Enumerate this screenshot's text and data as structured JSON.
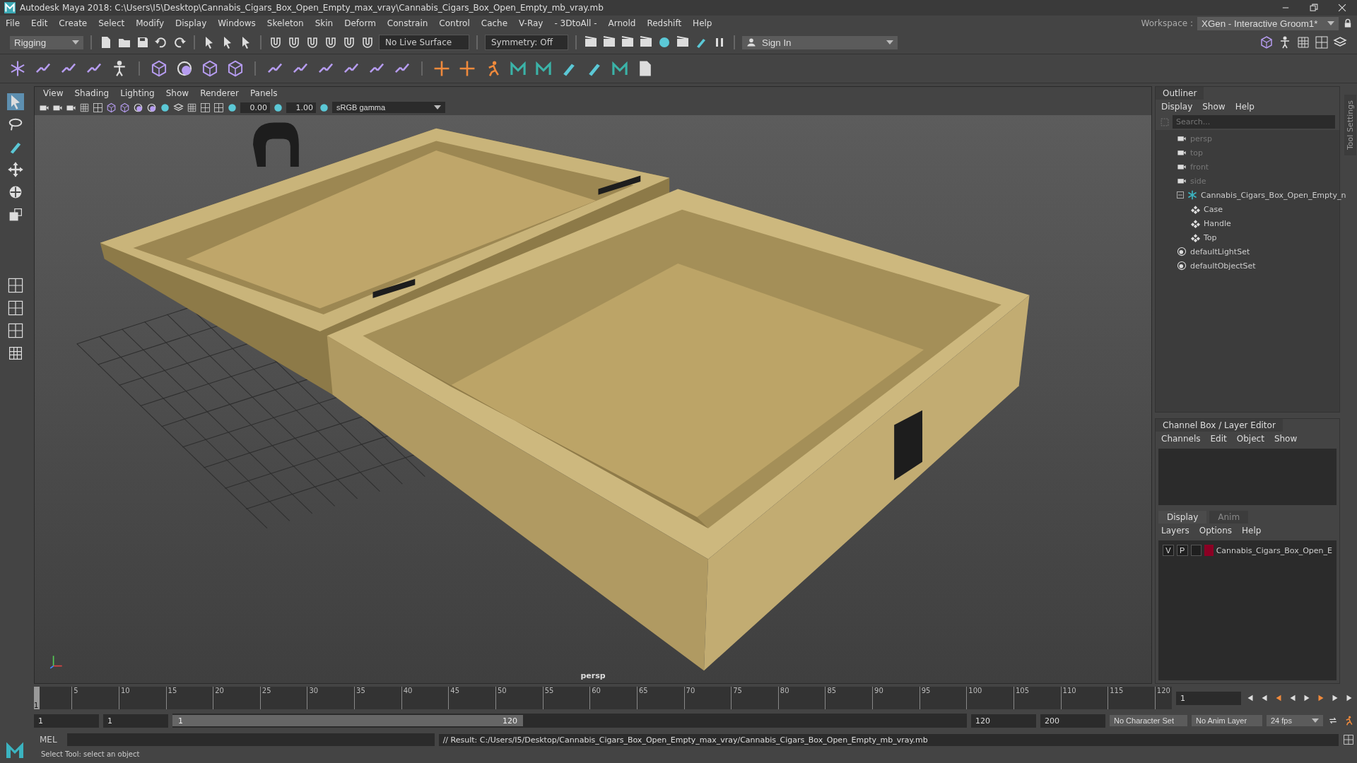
{
  "window": {
    "title": "Autodesk Maya 2018: C:\\Users\\I5\\Desktop\\Cannabis_Cigars_Box_Open_Empty_max_vray\\Cannabis_Cigars_Box_Open_Empty_mb_vray.mb"
  },
  "menu": [
    "File",
    "Edit",
    "Create",
    "Select",
    "Modify",
    "Display",
    "Windows",
    "Skeleton",
    "Skin",
    "Deform",
    "Constrain",
    "Control",
    "Cache",
    "V-Ray",
    "- 3DtoAll -",
    "Arnold",
    "Redshift",
    "Help"
  ],
  "workspace": {
    "label": "Workspace :",
    "value": "XGen - Interactive Groom1*"
  },
  "status_line": {
    "mode": "Rigging",
    "live_surface": "No Live Surface",
    "symmetry": "Symmetry: Off",
    "sign_in": "Sign In"
  },
  "viewport": {
    "menu": [
      "View",
      "Shading",
      "Lighting",
      "Show",
      "Renderer",
      "Panels"
    ],
    "exposure": "0.00",
    "gamma": "1.00",
    "color_space": "sRGB gamma",
    "camera": "persp"
  },
  "outliner": {
    "title": "Outliner",
    "menu": [
      "Display",
      "Show",
      "Help"
    ],
    "search": {
      "placeholder": "Search..."
    },
    "items": [
      {
        "label": "persp",
        "kind": "camera"
      },
      {
        "label": "top",
        "kind": "camera"
      },
      {
        "label": "front",
        "kind": "camera"
      },
      {
        "label": "side",
        "kind": "camera"
      },
      {
        "label": "Cannabis_Cigars_Box_Open_Empty_n",
        "kind": "group",
        "expanded": true,
        "children": [
          {
            "label": "Case",
            "kind": "mesh"
          },
          {
            "label": "Handle",
            "kind": "mesh"
          },
          {
            "label": "Top",
            "kind": "mesh"
          }
        ]
      },
      {
        "label": "defaultLightSet",
        "kind": "set"
      },
      {
        "label": "defaultObjectSet",
        "kind": "set"
      }
    ]
  },
  "tool_settings_tab": "Tool Settings",
  "channel_box": {
    "title": "Channel Box / Layer Editor",
    "menu": [
      "Channels",
      "Edit",
      "Object",
      "Show"
    ]
  },
  "layer_editor": {
    "tabs": [
      {
        "label": "Display",
        "selected": true
      },
      {
        "label": "Anim",
        "selected": false
      }
    ],
    "menu": [
      "Layers",
      "Options",
      "Help"
    ],
    "layers": [
      {
        "visible": "V",
        "playback": "P",
        "color": "#8b0024",
        "name": "Cannabis_Cigars_Box_Open_E"
      }
    ]
  },
  "timeline": {
    "start_label": "1",
    "ticks": [
      "5",
      "10",
      "15",
      "20",
      "25",
      "30",
      "35",
      "40",
      "45",
      "50",
      "55",
      "60",
      "65",
      "70",
      "75",
      "80",
      "85",
      "90",
      "95",
      "100",
      "105",
      "110",
      "115",
      "120"
    ],
    "current_frame": "1",
    "level": 0
  },
  "range": {
    "start": "1",
    "playback_start": "1",
    "slider_start": "1",
    "slider_end": "120",
    "playback_end": "120",
    "end": "200",
    "character_set": "No Character Set",
    "anim_layer": "No Anim Layer",
    "fps": "24 fps"
  },
  "command_line": {
    "language": "MEL",
    "result": "// Result: C:/Users/I5/Desktop/Cannabis_Cigars_Box_Open_Empty_max_vray/Cannabis_Cigars_Box_Open_Empty_mb_vray.mb"
  },
  "help_line": "Select Tool: select an object"
}
